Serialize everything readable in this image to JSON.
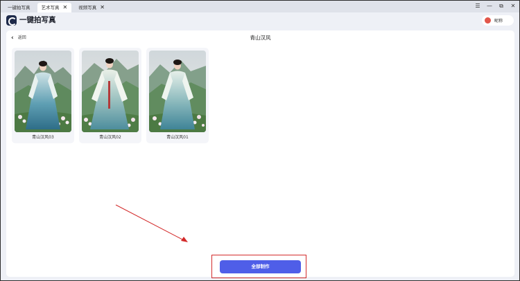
{
  "tabs": [
    {
      "label": "一键拍写真",
      "active": false,
      "closable": false
    },
    {
      "label": "艺术写真",
      "active": true,
      "closable": true
    },
    {
      "label": "视频写真",
      "active": false,
      "closable": true
    }
  ],
  "window_controls": {
    "menu": "☰",
    "minimize": "—",
    "restore": "⧉",
    "close": "✕"
  },
  "app": {
    "title": "一键拍写真"
  },
  "user": {
    "name": "昵称"
  },
  "page": {
    "back_label": "返回",
    "title": "青山汉风"
  },
  "cards": [
    {
      "label": "青山汉风03"
    },
    {
      "label": "青山汉风02"
    },
    {
      "label": "青山汉风01"
    }
  ],
  "action": {
    "label": "全部制作"
  },
  "colors": {
    "accent": "#4f5ee8",
    "annotation": "#d32a2a"
  }
}
